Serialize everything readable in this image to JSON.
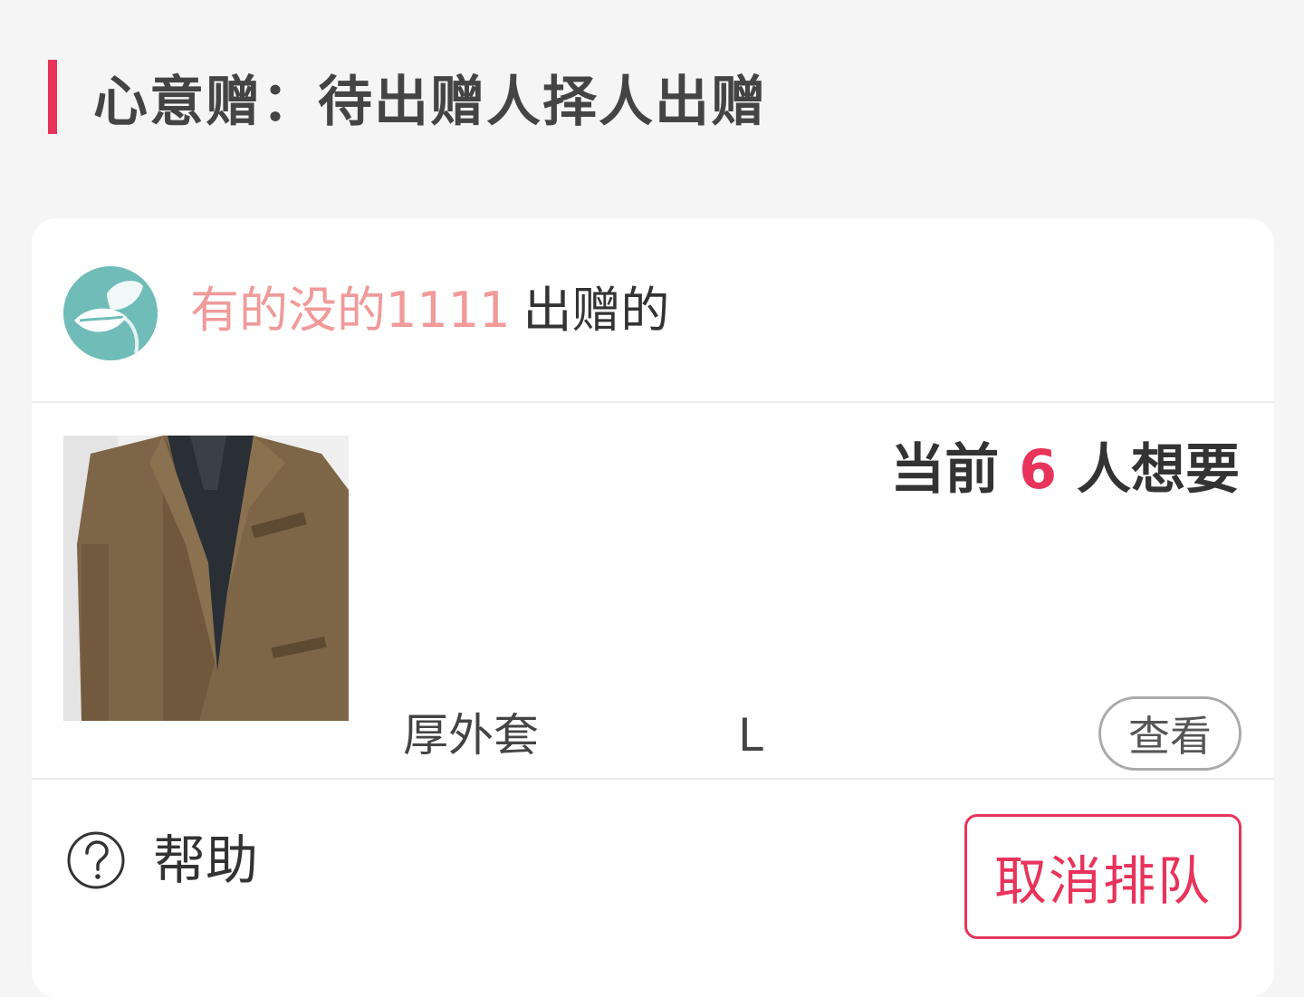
{
  "section": {
    "title": "心意赠：待出赠人择人出赠",
    "accent_color": "#e8335a"
  },
  "owner": {
    "name": "有的没的1111",
    "suffix": "出赠的",
    "avatar_icon": "leaf-avatar-icon"
  },
  "item": {
    "want_prefix": "当前",
    "want_count": "6",
    "want_suffix": "人想要",
    "name": "厚外套",
    "size": "L",
    "view_label": "查看",
    "image_icon": "jacket-photo"
  },
  "footer": {
    "help_icon": "question-circle-icon",
    "help_label": "帮助",
    "cancel_label": "取消排队"
  }
}
